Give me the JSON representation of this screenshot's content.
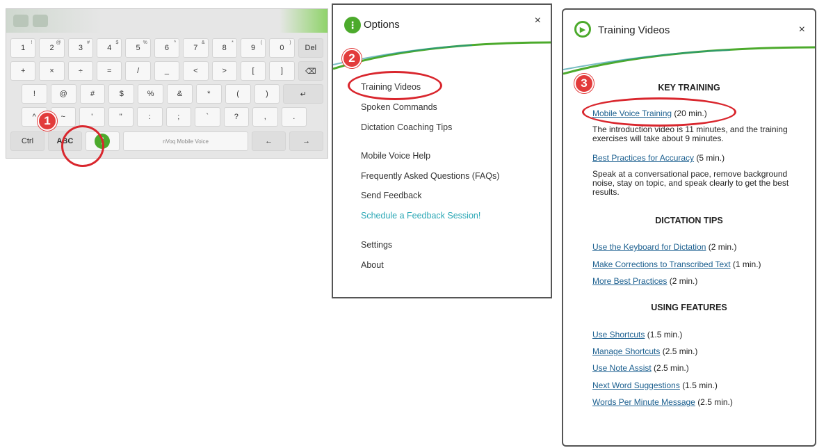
{
  "keyboard": {
    "row1": [
      {
        "main": "1",
        "sup": "!"
      },
      {
        "main": "2",
        "sup": "@"
      },
      {
        "main": "3",
        "sup": "#"
      },
      {
        "main": "4",
        "sup": "$"
      },
      {
        "main": "5",
        "sup": "%"
      },
      {
        "main": "6",
        "sup": "^"
      },
      {
        "main": "7",
        "sup": "&"
      },
      {
        "main": "8",
        "sup": "*"
      },
      {
        "main": "9",
        "sup": "("
      },
      {
        "main": "0",
        "sup": ")"
      },
      {
        "main": "Del",
        "sup": ""
      }
    ],
    "row2": [
      "+",
      "×",
      "÷",
      "=",
      "/",
      "_",
      "<",
      ">",
      "[",
      "]",
      "⌫"
    ],
    "row3": [
      "!",
      "@",
      "#",
      "$",
      "%",
      "&",
      "*",
      "(",
      ")",
      "↵"
    ],
    "row4": [
      "^",
      "~",
      "'",
      "\"",
      ":",
      ";",
      "`",
      "?",
      ",",
      "."
    ],
    "row5": {
      "ctrl": "Ctrl",
      "abc": "ABC",
      "space_label": "nVoq Mobile Voice",
      "left_arrow": "←",
      "right_arrow": "→"
    }
  },
  "options": {
    "title": "Options",
    "close": "×",
    "items": [
      {
        "label": "Training Videos"
      },
      {
        "label": "Spoken Commands"
      },
      {
        "label": "Dictation Coaching Tips"
      },
      {
        "label": "Mobile Voice Help"
      },
      {
        "label": "Frequently Asked Questions (FAQs)"
      },
      {
        "label": "Send Feedback"
      },
      {
        "label": "Schedule a Feedback Session!"
      },
      {
        "label": "Settings"
      },
      {
        "label": "About"
      }
    ]
  },
  "training": {
    "title": "Training Videos",
    "close": "×",
    "sections": {
      "key": "KEY TRAINING",
      "dictation": "DICTATION TIPS",
      "features": "USING FEATURES"
    },
    "key_items": [
      {
        "link": "Mobile Voice Training",
        "dur": "(20 min.)",
        "desc": "The introduction video is 11 minutes, and the training exercises will take about 9 minutes."
      },
      {
        "link": "Best Practices for Accuracy",
        "dur": "(5 min.)",
        "desc": "Speak at a conversational pace, remove background noise, stay on topic, and speak clearly to get the best results."
      }
    ],
    "dictation_items": [
      {
        "link": "Use the Keyboard for Dictation",
        "dur": "(2 min.)"
      },
      {
        "link": "Make Corrections to Transcribed Text",
        "dur": "(1 min.)"
      },
      {
        "link": "More Best Practices",
        "dur": "(2 min.)"
      }
    ],
    "feature_items": [
      {
        "link": "Use Shortcuts",
        "dur": "(1.5 min.)"
      },
      {
        "link": "Manage Shortcuts",
        "dur": "(2.5 min.)"
      },
      {
        "link": "Use Note Assist",
        "dur": "(2.5 min.)"
      },
      {
        "link": "Next Word Suggestions",
        "dur": "(1.5 min.)"
      },
      {
        "link": "Words Per Minute Message",
        "dur": "(2.5 min.)"
      }
    ]
  },
  "annotations": [
    "1",
    "2",
    "3"
  ],
  "colors": {
    "brand_green": "#4caa2c",
    "link_teal": "#2aa7b5",
    "link_blue": "#1b5f8f",
    "annotation_red": "#d9262d"
  }
}
